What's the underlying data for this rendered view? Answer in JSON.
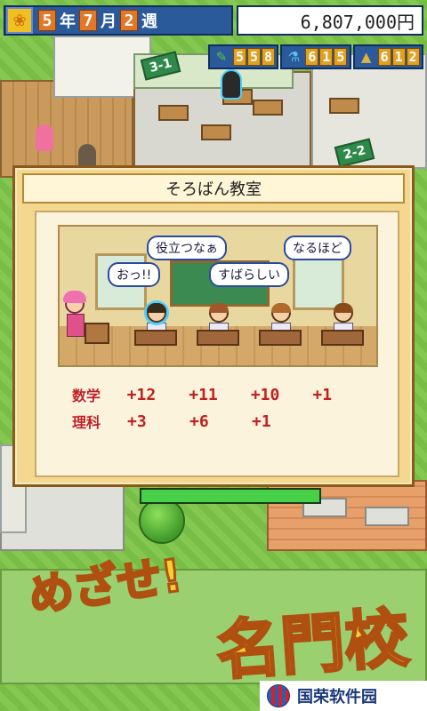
{
  "hud": {
    "year": "5",
    "year_kanji": "年",
    "month": "7",
    "month_kanji": "月",
    "week": "2",
    "week_kanji": "週",
    "money": "6,807,000円",
    "season_icon": "sunflower-icon",
    "stats": [
      {
        "icon": "pencil-icon",
        "value": [
          "5",
          "5",
          "8"
        ]
      },
      {
        "icon": "flask-icon",
        "value": [
          "6",
          "1",
          "5"
        ]
      },
      {
        "icon": "cone-icon",
        "value": [
          "6",
          "1",
          "2"
        ]
      }
    ]
  },
  "scene": {
    "sign_1": "3-1",
    "sign_2": "2-2"
  },
  "dialog": {
    "title": "そろばん教室",
    "bubbles": [
      "おっ!!",
      "役立つなぁ",
      "すばらしい",
      "なるほど"
    ],
    "subjects": [
      {
        "name": "数学",
        "gains": [
          "+12",
          "+11",
          "+10",
          "+1"
        ]
      },
      {
        "name": "理科",
        "gains": [
          "+3",
          "+6",
          "+1"
        ]
      }
    ],
    "progress": 1.0
  },
  "banner": {
    "line1": "めざせ!",
    "line2": "名門校"
  },
  "watermark": {
    "text": "国荣软件园"
  },
  "colors": {
    "hud_blue": "#2a5a9a",
    "dialog_bg": "#f4d890",
    "gain_red": "#c02020",
    "progress_green": "#48d048",
    "banner_yellow": "#f8d030"
  }
}
